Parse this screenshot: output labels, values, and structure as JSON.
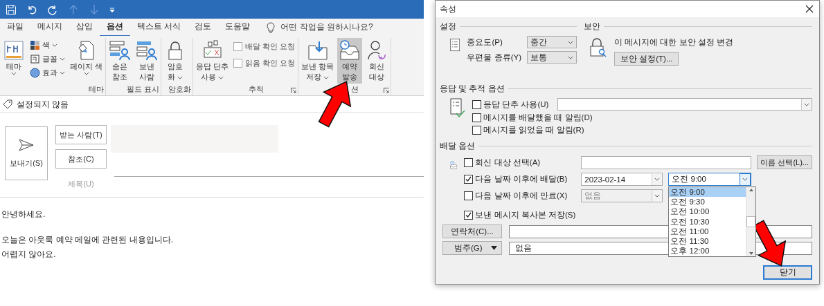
{
  "menu_tabs": [
    {
      "label": "파일",
      "selected": false
    },
    {
      "label": "메시지",
      "selected": false
    },
    {
      "label": "삽입",
      "selected": false
    },
    {
      "label": "옵션",
      "selected": true
    },
    {
      "label": "텍스트 서식",
      "selected": false
    },
    {
      "label": "검토",
      "selected": false
    },
    {
      "label": "도움말",
      "selected": false
    }
  ],
  "tell_me": "어떤 작업을 원하시나요?",
  "ribbon": {
    "groups": [
      {
        "label": "테마",
        "launcher": false,
        "items": [
          {
            "kind": "big",
            "label": "테마",
            "dropdown": true,
            "highlighted": false
          },
          {
            "kind": "small",
            "label": "색",
            "dropdown": true,
            "highlighted": false
          },
          {
            "kind": "small",
            "label": "글꼴",
            "dropdown": true,
            "highlighted": false
          },
          {
            "kind": "small",
            "label": "효과",
            "dropdown": true,
            "highlighted": false
          },
          {
            "kind": "big",
            "label": "페이지 색",
            "dropdown": true,
            "highlighted": false
          }
        ]
      },
      {
        "label": "필드 표시",
        "launcher": false,
        "items": [
          {
            "kind": "big",
            "label": "숨은\n참조",
            "dropdown": false,
            "highlighted": false
          },
          {
            "kind": "big",
            "label": "보낸\n사람",
            "dropdown": false,
            "highlighted": false
          }
        ]
      },
      {
        "label": "암호화",
        "launcher": false,
        "items": [
          {
            "kind": "big",
            "label": "암호\n화",
            "dropdown": true,
            "highlighted": false
          }
        ]
      },
      {
        "label": "추적",
        "launcher": true,
        "items": [
          {
            "kind": "big",
            "label": "응답 단추\n사용",
            "dropdown": true,
            "highlighted": false
          },
          {
            "kind": "check",
            "label": "배달 확인 요청",
            "checked": false,
            "highlighted": false
          },
          {
            "kind": "check",
            "label": "읽음 확인 요청",
            "checked": false,
            "highlighted": false
          }
        ]
      },
      {
        "label": "션",
        "launcher": true,
        "items": [
          {
            "kind": "big",
            "label": "보낸 항목\n저장",
            "dropdown": true,
            "highlighted": false
          },
          {
            "kind": "big",
            "label": "예약\n발송",
            "dropdown": false,
            "highlighted": true
          },
          {
            "kind": "big",
            "label": "회신\n대상",
            "dropdown": false,
            "highlighted": false
          }
        ]
      }
    ]
  },
  "sensitivity": "설정되지 않음",
  "compose": {
    "send_button": "보내기(S)",
    "to_button": "받는 사람(T)",
    "cc_button": "참조(C)",
    "subject_label": "제목(U)"
  },
  "body": [
    [
      "안녕하세요."
    ],
    [
      "오늘은 아웃룩 예약 메일에 관련된 내용입니다.",
      "어렵지 않아요."
    ]
  ],
  "dialog": {
    "title": "속성",
    "settings": {
      "heading": "설정",
      "fields": [
        {
          "label": "중요도(P)",
          "value": "중간"
        },
        {
          "label": "우편물 종류(Y)",
          "value": "보통"
        }
      ]
    },
    "security": {
      "heading": "보안",
      "text": "이 메시지에 대한 보안 설정 변경",
      "button": "보안 설정(T)..."
    },
    "tracking": {
      "heading": "응답 및 추적 옵션",
      "options": [
        {
          "kind": "combo",
          "label": "응답 단추 사용(U)",
          "checked": false
        },
        {
          "kind": "plain",
          "label": "메시지를 배달했을 때 알림(D)",
          "checked": false
        },
        {
          "kind": "plain",
          "label": "메시지를 읽었을 때 알림(R)",
          "checked": false
        }
      ]
    },
    "delivery": {
      "heading": "배달 옵션",
      "reply_to": {
        "label": "회신 대상 선택(A)",
        "checked": false,
        "button": "이름 선택(L)..."
      },
      "deliver_after": {
        "label": "다음 날짜 이후에 배달(B)",
        "checked": true,
        "date": "2023-02-14",
        "time": "오전 9:00",
        "disabled": false
      },
      "expire_after": {
        "label": "다음 날짜 이후에 만료(X)",
        "checked": false,
        "date": "없음",
        "disabled": true
      },
      "save_copy": {
        "label": "보낸 메시지 복사본 저장(S)",
        "checked": true
      },
      "contacts_button": "연락처(C)...",
      "categories": {
        "button": "범주(G)",
        "value": "없음"
      }
    },
    "time_list": [
      {
        "label": "오전 9:00",
        "selected": true
      },
      {
        "label": "오전 9:30",
        "selected": false
      },
      {
        "label": "오전 10:00",
        "selected": false
      },
      {
        "label": "오전 10:30",
        "selected": false
      },
      {
        "label": "오전 11:00",
        "selected": false
      },
      {
        "label": "오전 11:30",
        "selected": false
      },
      {
        "label": "오후 12:00",
        "selected": false
      }
    ],
    "close_button": "닫기"
  }
}
